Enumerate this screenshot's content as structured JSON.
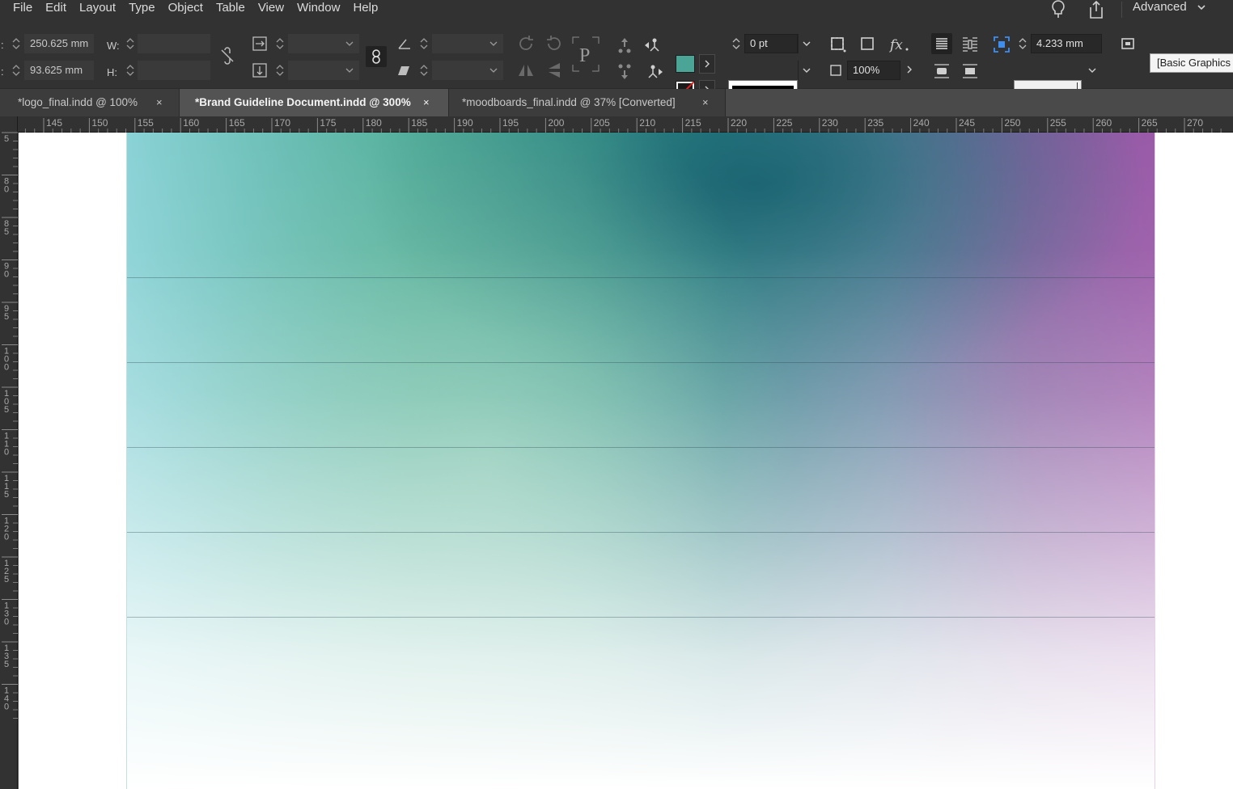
{
  "menu": {
    "items": [
      "File",
      "Edit",
      "Layout",
      "Type",
      "Object",
      "Table",
      "View",
      "Window",
      "Help"
    ],
    "workspace": "Advanced"
  },
  "control": {
    "x_value": "250.625 mm",
    "y_value": "93.625 mm",
    "w_label": "W:",
    "h_label": "H:",
    "stroke_weight": "0 pt",
    "opacity": "100%",
    "offset_value": "4.233 mm",
    "object_style": "[Basic Graphics Frame]",
    "fill_color": "#4aa596"
  },
  "tabs": [
    {
      "label": "*logo_final.indd @ 100%",
      "active": false
    },
    {
      "label": "*Brand Guideline Document.indd @ 300%",
      "active": true
    },
    {
      "label": "*moodboards_final.indd @ 37% [Converted]",
      "active": false
    }
  ],
  "close_glyph": "×",
  "hruler_labels": [
    "145",
    "150",
    "155",
    "160",
    "165",
    "170",
    "175",
    "180",
    "185",
    "190",
    "195",
    "200",
    "205",
    "210",
    "215",
    "220",
    "225",
    "230",
    "235",
    "240",
    "245",
    "250",
    "255",
    "260",
    "265",
    "270"
  ],
  "vruler_labels": [
    "5",
    "80",
    "85",
    "90",
    "95",
    "100",
    "105",
    "110",
    "115",
    "120",
    "125",
    "130",
    "135",
    "140"
  ]
}
